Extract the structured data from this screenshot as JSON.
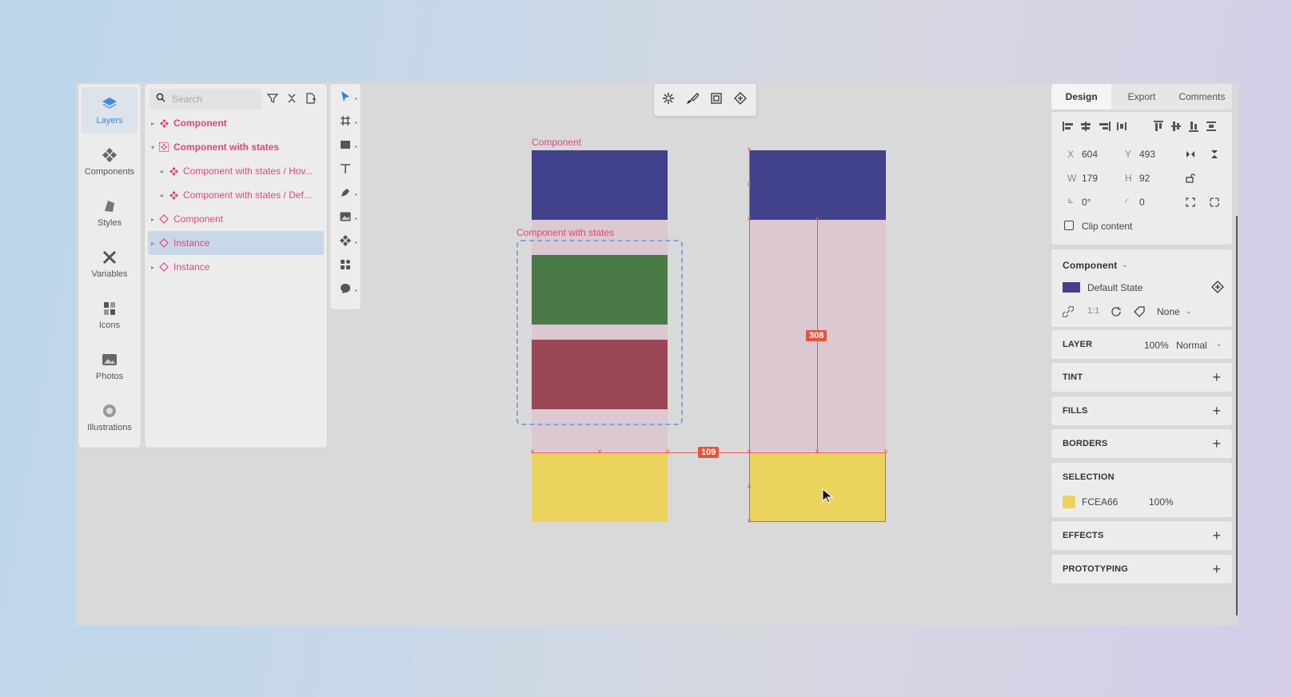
{
  "sidebar": {
    "items": [
      {
        "label": "Layers",
        "icon": "layers-icon",
        "active": true
      },
      {
        "label": "Components",
        "icon": "components-icon"
      },
      {
        "label": "Styles",
        "icon": "styles-icon"
      },
      {
        "label": "Variables",
        "icon": "variables-icon"
      },
      {
        "label": "Icons",
        "icon": "icons-icon"
      },
      {
        "label": "Photos",
        "icon": "photos-icon"
      },
      {
        "label": "Illustrations",
        "icon": "illustrations-icon"
      }
    ]
  },
  "layers": {
    "search_placeholder": "Search",
    "rows": [
      {
        "label": "Component",
        "type": "component",
        "bold": true
      },
      {
        "label": "Component with states",
        "type": "component-set",
        "bold": true,
        "expanded": true
      },
      {
        "label": "Component with states / Hov...",
        "type": "component",
        "indent": 1
      },
      {
        "label": "Component with states / Def...",
        "type": "component",
        "indent": 1
      },
      {
        "label": "Component",
        "type": "instance"
      },
      {
        "label": "Instance",
        "type": "instance",
        "selected": true
      },
      {
        "label": "Instance",
        "type": "instance"
      }
    ]
  },
  "canvas": {
    "component_label": "Component",
    "states_label": "Component with states",
    "measure_horizontal": "109",
    "measure_vertical": "308",
    "colors": {
      "indigo": "#42418c",
      "green": "#4a7a48",
      "red": "#9a4755",
      "yellow": "#ecd35e",
      "pinkish": "#dcc8d0",
      "accent": "#e0457b",
      "measure": "#e5533d"
    }
  },
  "right_panel": {
    "tabs": [
      "Design",
      "Export",
      "Comments"
    ],
    "x_label": "X",
    "x_value": "604",
    "y_label": "Y",
    "y_value": "493",
    "w_label": "W",
    "w_value": "179",
    "h_label": "H",
    "h_value": "92",
    "rotation": "0°",
    "radius": "0",
    "clip_content": "Clip content",
    "component_title": "Component",
    "component_state": "Default State",
    "component_ratio": "1:1",
    "component_none": "None",
    "layer_title": "LAYER",
    "layer_opacity": "100%",
    "layer_blend": "Normal",
    "tint_title": "TINT",
    "fills_title": "FILLS",
    "borders_title": "BORDERS",
    "selection_title": "SELECTION",
    "selection_color": "FCEA66",
    "selection_opacity": "100%",
    "effects_title": "EFFECTS",
    "prototyping_title": "PROTOTYPING"
  }
}
